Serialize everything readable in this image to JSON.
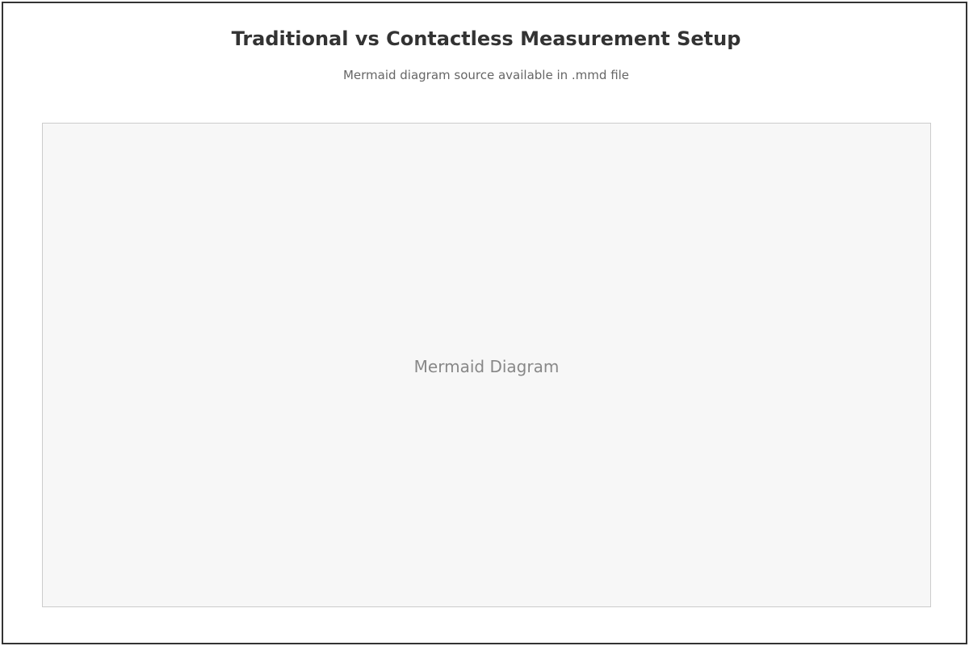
{
  "title": "Traditional vs Contactless Measurement Setup",
  "subtitle": "Mermaid diagram source available in .mmd file",
  "diagram": {
    "placeholder_text": "Mermaid Diagram"
  },
  "colors": {
    "border": "#333333",
    "title": "#333333",
    "subtitle": "#666666",
    "panel_background": "#f7f7f7",
    "panel_border": "#cccccc",
    "placeholder_text": "#888888"
  }
}
